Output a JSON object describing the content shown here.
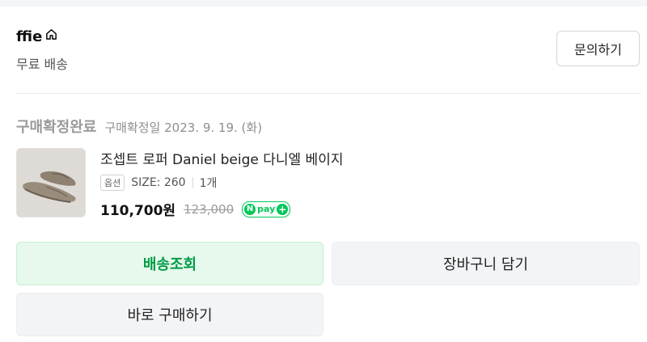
{
  "store": {
    "name": "ffie",
    "shipping": "무료 배송",
    "inquiry_button": "문의하기"
  },
  "order": {
    "status": "구매확정완료",
    "confirm_date": "구매확정일 2023. 9. 19. (화)"
  },
  "product": {
    "title": "조셉트 로퍼 Daniel beige 다니엘 베이지",
    "option_tag": "옵션",
    "option_size": "SIZE: 260",
    "quantity": "1개",
    "price": "110,700원",
    "original_price": "123,000",
    "npay_label": "pay"
  },
  "actions": {
    "tracking": "배송조회",
    "cart": "장바구니 담기",
    "buy_again": "바로 구매하기"
  },
  "colors": {
    "accent_green": "#03c75a",
    "tracking_text": "#009b46",
    "tracking_bg": "#e6f9ec"
  }
}
